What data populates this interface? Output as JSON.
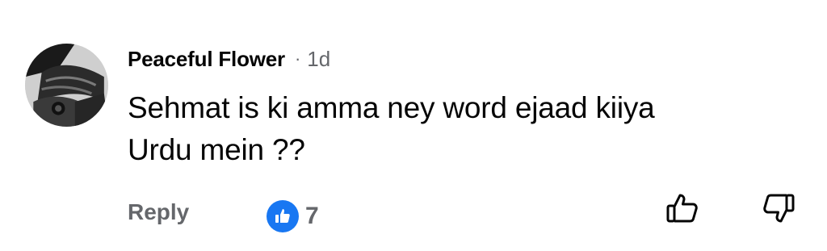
{
  "comment": {
    "author": "Peaceful Flower",
    "separator": "·",
    "time": "1d",
    "text_line1": "Sehmat is ki amma ney word ejaad kiiya",
    "text_line2": "Urdu mein ??"
  },
  "actions": {
    "reply_label": "Reply",
    "like_count": "7"
  },
  "icons": {
    "avatar": "profile-photo",
    "like_badge": "thumbs-up-badge-icon",
    "react_like": "thumbs-up-outline-icon",
    "react_dislike": "thumbs-down-outline-icon"
  },
  "colors": {
    "text": "#050505",
    "secondary": "#65676b",
    "like_blue": "#1877f2"
  }
}
